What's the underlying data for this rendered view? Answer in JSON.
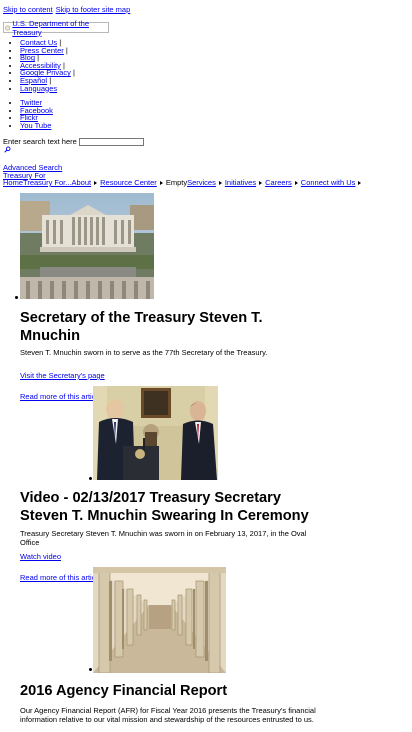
{
  "skip": {
    "content": "Skip to content",
    "footer": "Skip to footer site map"
  },
  "logo": {
    "text": "U.S. Department of the Treasury"
  },
  "utility_links": [
    {
      "label": "Contact Us",
      "sep": "|"
    },
    {
      "label": "Press Center",
      "sep": "|"
    },
    {
      "label": "Blog",
      "sep": "|"
    },
    {
      "label": "Accessibility",
      "sep": "|"
    },
    {
      "label": "Google Privacy",
      "sep": "|"
    },
    {
      "label": "Español",
      "sep": "|"
    },
    {
      "label": "Languages",
      "sep": ""
    }
  ],
  "social_links": [
    "Twitter",
    "Facebook",
    "Flickr",
    "You Tube"
  ],
  "search": {
    "label": "Enter search text here",
    "value": "",
    "advanced": "Advanced Search"
  },
  "treasury_for": "Treasury For",
  "nav": {
    "home": "Home",
    "treasury_for": "Treasury For...",
    "about": "About",
    "resource_center": "Resource Center",
    "empty": "Empty",
    "services": "Services",
    "initiatives": "Initiatives",
    "careers": "Careers",
    "connect": "Connect with Us"
  },
  "slides": [
    {
      "title_line1": "Secretary of the Treasury Steven T.",
      "title_line2": "Mnuchin",
      "desc_line1": "Steven T. Mnuchin sworn in to serve as the 77th Secretary of the Treasury.",
      "desc_line2": "",
      "link": "Visit the Secretary's page",
      "more": "Read more of this article"
    },
    {
      "title_line1": "Video - 02/13/2017 Treasury Secretary",
      "title_line2": "Steven T. Mnuchin Swearing In Ceremony",
      "desc_line1": "Treasury Secretary Steven T. Mnuchin was sworn in on February 13, 2017, in the Oval",
      "desc_line2": "Office",
      "link": "Watch video",
      "more": "Read more of this article"
    },
    {
      "title_line1": "2016 Agency Financial Report",
      "title_line2": "",
      "desc_line1": "Our Agency Financial Report (AFR) for Fiscal Year 2016 presents the Treasury's financial",
      "desc_line2": "information relative to our vital mission and stewardship of the resources entrusted to us.",
      "link": "",
      "more": ""
    }
  ],
  "icons": {
    "seal": "treasury-seal-icon",
    "search": "magnifier-icon",
    "nav_arrow": "triangle-right-icon"
  },
  "colors": {
    "link": "#0000ee",
    "text": "#000000",
    "background": "#ffffff"
  }
}
